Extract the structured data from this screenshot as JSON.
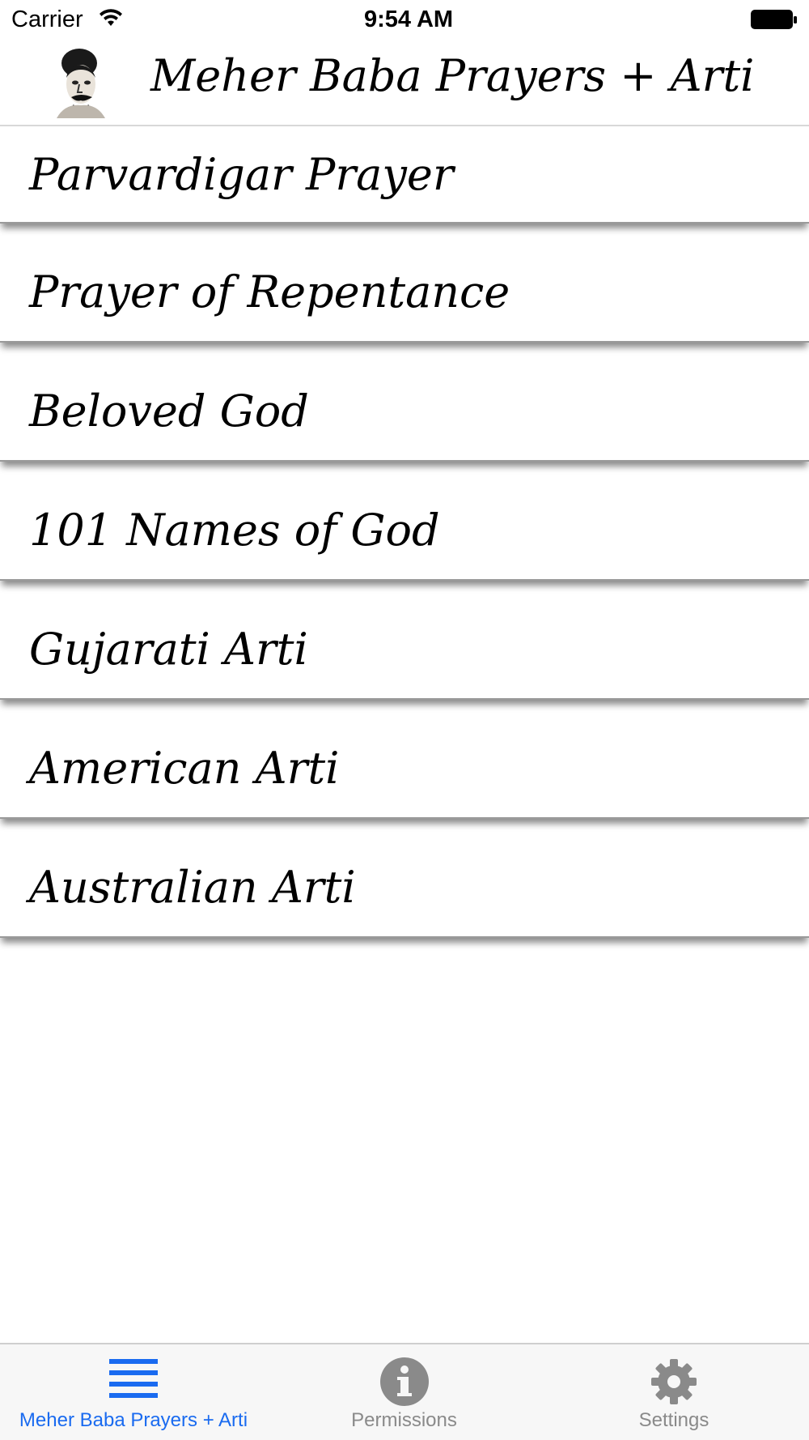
{
  "status_bar": {
    "carrier": "Carrier",
    "time": "9:54 AM"
  },
  "nav": {
    "title": "Meher Baba Prayers + Arti"
  },
  "list": {
    "items": [
      {
        "label": "Parvardigar Prayer"
      },
      {
        "label": "Prayer of Repentance"
      },
      {
        "label": "Beloved God"
      },
      {
        "label": "101 Names of God"
      },
      {
        "label": "Gujarati Arti"
      },
      {
        "label": "American Arti"
      },
      {
        "label": "Australian Arti"
      }
    ]
  },
  "tab_bar": {
    "tabs": [
      {
        "label": "Meher Baba Prayers + Arti",
        "icon": "list-icon",
        "active": true
      },
      {
        "label": "Permissions",
        "icon": "info-icon",
        "active": false
      },
      {
        "label": "Settings",
        "icon": "gear-icon",
        "active": false
      }
    ],
    "active_color": "#1a6bf0",
    "inactive_color": "#8a8a8a"
  }
}
